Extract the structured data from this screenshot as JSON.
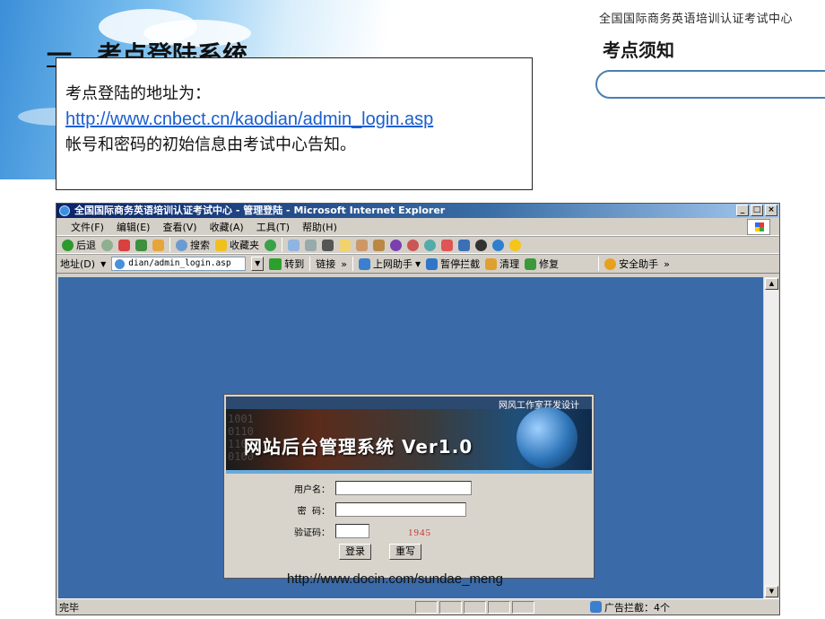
{
  "slide": {
    "org_name": "全国国际商务英语培训认证考试中心",
    "notice_title": "考点须知",
    "section_title": "一、考点登陆系统"
  },
  "callout": {
    "line1": "考点登陆的地址为：",
    "url": "http://www.cnbect.cn/kaodian/admin_login.asp",
    "line3": "帐号和密码的初始信息由考试中心告知。"
  },
  "browser": {
    "title": "全国国际商务英语培训认证考试中心 - 管理登陆 - Microsoft Internet Explorer",
    "window_buttons": [
      "_",
      "□",
      "×"
    ],
    "menu": [
      "文件(F)",
      "编辑(E)",
      "查看(V)",
      "收藏(A)",
      "工具(T)",
      "帮助(H)"
    ],
    "toolbar": {
      "back": "后退",
      "search": "搜索",
      "favorites": "收藏夹"
    },
    "address": {
      "label": "地址(D)",
      "value": "dian/admin_login.asp",
      "go": "转到",
      "links": "链接",
      "more": "»",
      "assistant": "上网助手",
      "pause_block": "暂停拦截",
      "clean": "清理",
      "repair": "修复",
      "safety": "安全助手"
    },
    "status": {
      "text": "完毕",
      "ad_block": "广告拦截：4个"
    }
  },
  "login": {
    "credit": "网风工作室开发设计",
    "system_title": "网站后台管理系统 Ver1.0",
    "username_label": "用户名：",
    "password_label": "密  码：",
    "captcha_label": "验证码：",
    "captcha_value": "1945",
    "login_button": "登录",
    "reset_button": "重写"
  },
  "footer": {
    "url": "http://www.docin.com/sundae_meng"
  }
}
